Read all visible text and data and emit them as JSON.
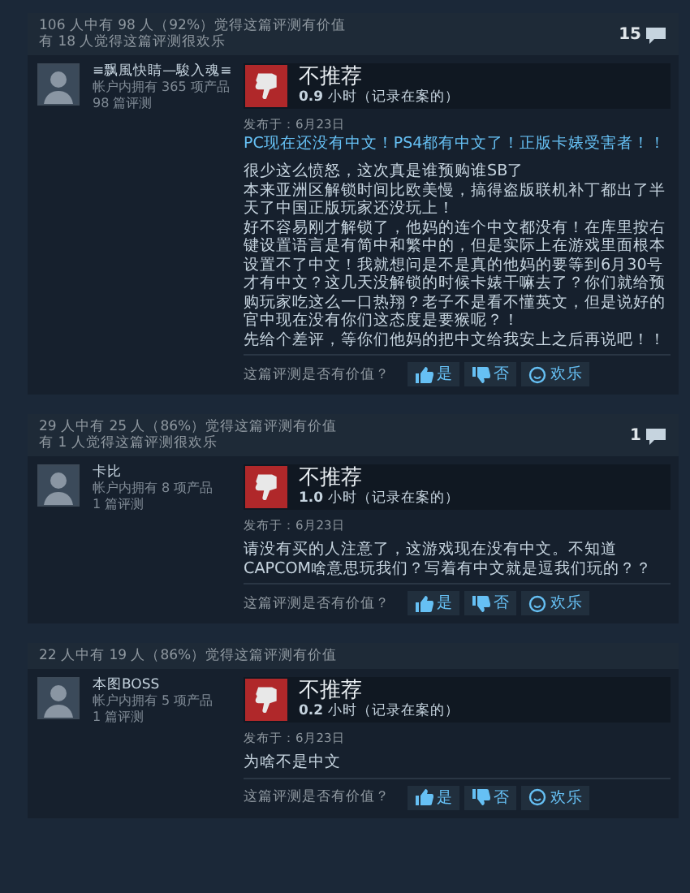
{
  "reviews": [
    {
      "helpful": "106 人中有 98 人（92%）觉得这篇评测有价值",
      "funny": "有 18 人觉得这篇评测很欢乐",
      "comments": "15",
      "author": {
        "name": "≡飘風快睛—駿入魂≡",
        "products": "帐户内拥有 365 项产品",
        "reviews": "98 篇评测"
      },
      "recommended": false,
      "verdict": "不推荐",
      "hours": "**0.9** 小时（记录在案的）",
      "posted": "发布于：6月23日",
      "title": "PC现在还没有中文！PS4都有中文了！正版卡婊受害者！！",
      "body": [
        "很少这么愤怒，这次真是谁预购谁SB了",
        "本来亚洲区解锁时间比欧美慢，搞得盗版联机补丁都出了半天了中国正版玩家还没玩上！",
        "好不容易刚才解锁了，他妈的连个中文都没有！在库里按右键设置语言是有简中和繁中的，但是实际上在游戏里面根本设置不了中文！我就想问是不是真的他妈的要等到6月30号才有中文？这几天没解锁的时候卡婊干嘛去了？你们就给预购玩家吃这么一口热翔？老子不是看不懂英文，但是说好的官中现在没有你们这态度是要猴呢？！",
        "先给个差评，等你们他妈的把中文给我安上之后再说吧！！"
      ],
      "prompt": "这篇评测是否有价值？",
      "votes": [
        {
          "kind": "yes",
          "label": "是"
        },
        {
          "kind": "no",
          "label": "否"
        },
        {
          "kind": "funny",
          "label": "欢乐"
        }
      ]
    },
    {
      "helpful": "29 人中有 25 人（86%）觉得这篇评测有价值",
      "funny": "有 1 人觉得这篇评测很欢乐",
      "comments": "1",
      "author": {
        "name": "卡比",
        "products": "帐户内拥有 8 项产品",
        "reviews": "1 篇评测"
      },
      "recommended": false,
      "verdict": "不推荐",
      "hours": "**1.0** 小时（记录在案的）",
      "posted": "发布于：6月23日",
      "body": [
        "请没有买的人注意了，这游戏现在没有中文。不知道CAPCOM啥意思玩我们？写着有中文就是逗我们玩的？？"
      ],
      "prompt": "这篇评测是否有价值？",
      "votes": [
        {
          "kind": "yes",
          "label": "是"
        },
        {
          "kind": "no",
          "label": "否"
        },
        {
          "kind": "funny",
          "label": "欢乐"
        }
      ]
    },
    {
      "helpful": "22 人中有 19 人（86%）觉得这篇评测有价值",
      "author": {
        "name": "本图BOSS",
        "products": "帐户内拥有 5 项产品",
        "reviews": "1 篇评测"
      },
      "recommended": false,
      "verdict": "不推荐",
      "hours": "**0.2** 小时（记录在案的）",
      "posted": "发布于：6月23日",
      "body": [
        "为啥不是中文"
      ],
      "prompt": "这篇评测是否有价值？",
      "votes": [
        {
          "kind": "yes",
          "label": "是"
        },
        {
          "kind": "no",
          "label": "否"
        },
        {
          "kind": "funny",
          "label": "欢乐"
        }
      ]
    }
  ]
}
